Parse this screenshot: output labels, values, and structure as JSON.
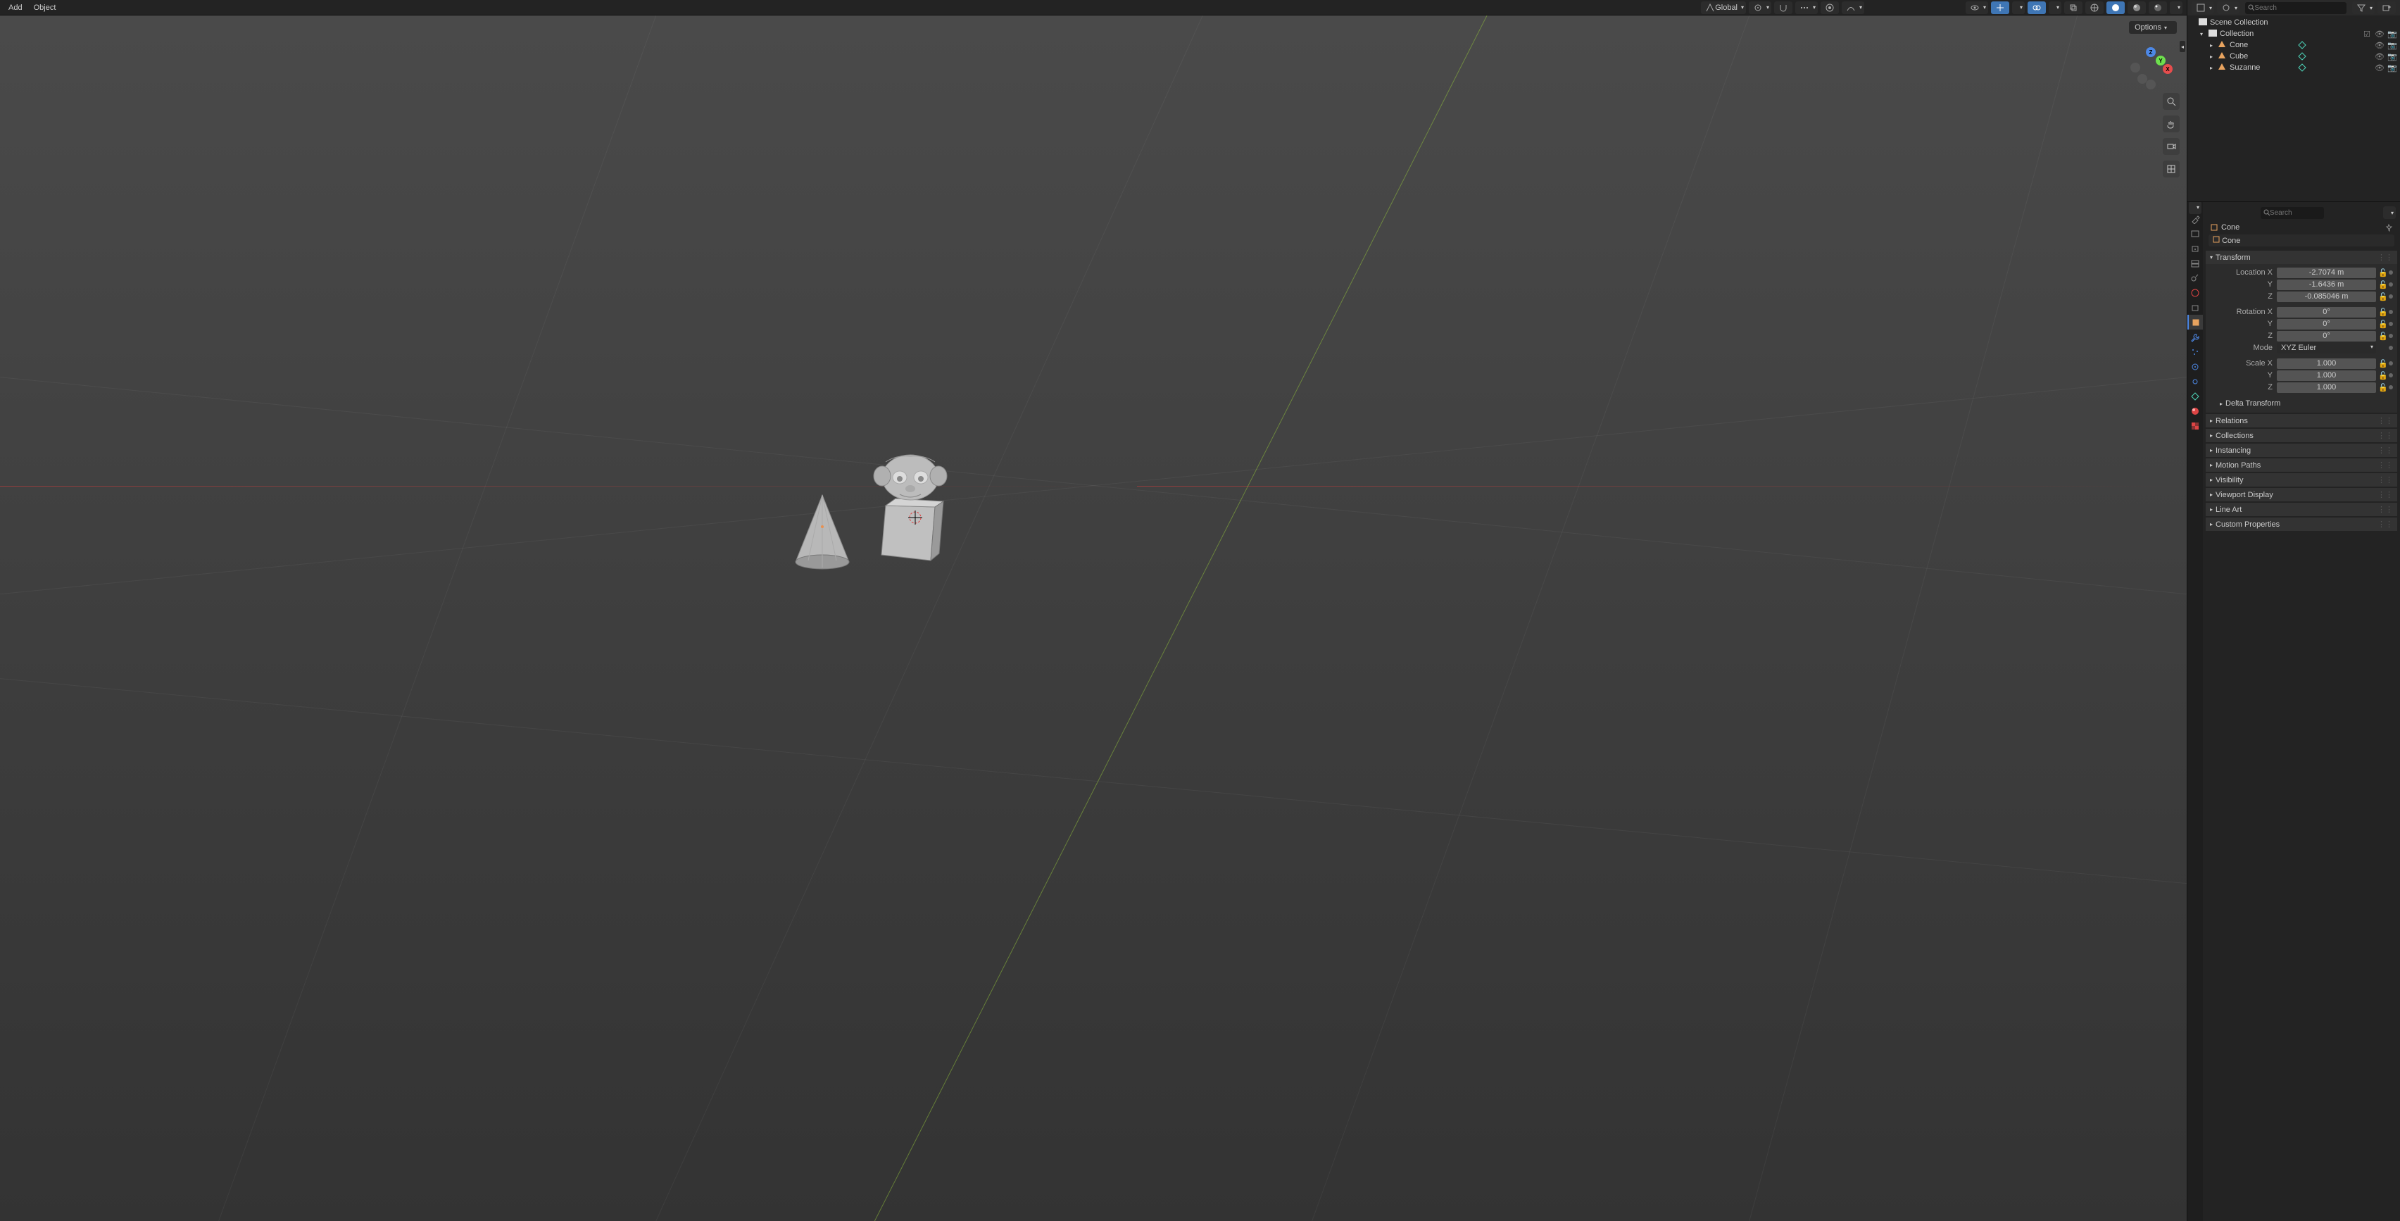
{
  "topbar": {
    "add": "Add",
    "object": "Object",
    "orientation": "Global",
    "options": "Options"
  },
  "gizmo": {
    "x": "X",
    "y": "Y",
    "z": "Z"
  },
  "outliner": {
    "search_placeholder": "Search",
    "scene_collection": "Scene Collection",
    "collection": "Collection",
    "items": [
      {
        "name": "Cone"
      },
      {
        "name": "Cube"
      },
      {
        "name": "Suzanne"
      }
    ]
  },
  "properties": {
    "search_placeholder": "Search",
    "breadcrumb": "Cone",
    "object_name": "Cone",
    "panels": {
      "transform": "Transform",
      "delta": "Delta Transform",
      "relations": "Relations",
      "collections": "Collections",
      "instancing": "Instancing",
      "motion": "Motion Paths",
      "visibility": "Visibility",
      "viewport_display": "Viewport Display",
      "lineart": "Line Art",
      "custom": "Custom Properties"
    },
    "transform": {
      "location_label": "Location X",
      "rotation_label": "Rotation X",
      "scale_label": "Scale X",
      "mode_label": "Mode",
      "y_label": "Y",
      "z_label": "Z",
      "loc_x": "-2.7074 m",
      "loc_y": "-1.6436 m",
      "loc_z": "-0.085046 m",
      "rot_x": "0°",
      "rot_y": "0°",
      "rot_z": "0°",
      "mode": "XYZ Euler",
      "scale_x": "1.000",
      "scale_y": "1.000",
      "scale_z": "1.000"
    }
  }
}
